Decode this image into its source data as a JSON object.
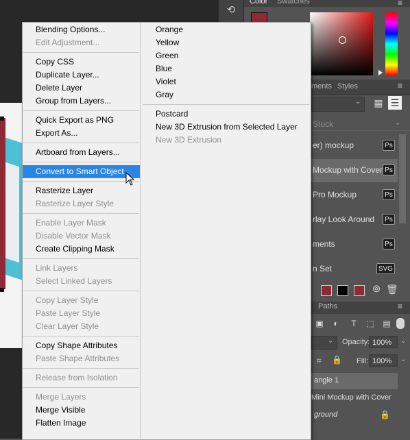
{
  "panels": {
    "color_tabs": [
      "Color",
      "Swatches"
    ],
    "library_tabs": [
      "ments",
      "Styles"
    ],
    "library_search": "Stock",
    "library_items": [
      {
        "label": "er) mockup",
        "badge": "Ps"
      },
      {
        "label": "Mockup with Cover",
        "badge": "Ps"
      },
      {
        "label": "Pro Mockup",
        "badge": "Ps"
      },
      {
        "label": "rlay Look Around",
        "badge": "Ps"
      },
      {
        "label": "ments",
        "badge": "Ps"
      },
      {
        "label": "n Set",
        "badge": "SVG"
      }
    ],
    "layers_tabs": [
      "Paths"
    ],
    "opacity_label": "Opacity:",
    "opacity_value": "100%",
    "fill_label": "Fill:",
    "fill_value": "100%",
    "layers": [
      "angle 1",
      "Mini Mockup with Cover",
      "ground"
    ]
  },
  "context_menu": {
    "main_groups": [
      [
        {
          "label": "Blending Options...",
          "enabled": true
        },
        {
          "label": "Edit Adjustment...",
          "enabled": false
        }
      ],
      [
        {
          "label": "Copy CSS",
          "enabled": true
        },
        {
          "label": "Duplicate Layer...",
          "enabled": true
        },
        {
          "label": "Delete Layer",
          "enabled": true
        },
        {
          "label": "Group from Layers...",
          "enabled": true
        }
      ],
      [
        {
          "label": "Quick Export as PNG",
          "enabled": true
        },
        {
          "label": "Export As...",
          "enabled": true
        }
      ],
      [
        {
          "label": "Artboard from Layers...",
          "enabled": true
        }
      ],
      [
        {
          "label": "Convert to Smart Object",
          "enabled": true,
          "highlighted": true
        }
      ],
      [
        {
          "label": "Rasterize Layer",
          "enabled": true
        },
        {
          "label": "Rasterize Layer Style",
          "enabled": false
        }
      ],
      [
        {
          "label": "Enable Layer Mask",
          "enabled": false
        },
        {
          "label": "Disable Vector Mask",
          "enabled": false
        },
        {
          "label": "Create Clipping Mask",
          "enabled": true
        }
      ],
      [
        {
          "label": "Link Layers",
          "enabled": false
        },
        {
          "label": "Select Linked Layers",
          "enabled": false
        }
      ],
      [
        {
          "label": "Copy Layer Style",
          "enabled": false
        },
        {
          "label": "Paste Layer Style",
          "enabled": false
        },
        {
          "label": "Clear Layer Style",
          "enabled": false
        }
      ],
      [
        {
          "label": "Copy Shape Attributes",
          "enabled": true
        },
        {
          "label": "Paste Shape Attributes",
          "enabled": false
        }
      ],
      [
        {
          "label": "Release from Isolation",
          "enabled": false
        }
      ],
      [
        {
          "label": "Merge Layers",
          "enabled": false
        },
        {
          "label": "Merge Visible",
          "enabled": true
        },
        {
          "label": "Flatten Image",
          "enabled": true
        }
      ]
    ],
    "color_labels": [
      "Orange",
      "Yellow",
      "Green",
      "Blue",
      "Violet",
      "Gray"
    ],
    "postcard_3d": [
      {
        "label": "Postcard",
        "enabled": true
      },
      {
        "label": "New 3D Extrusion from Selected Layer",
        "enabled": true
      },
      {
        "label": "New 3D Extrusion",
        "enabled": false
      }
    ]
  },
  "colors": {
    "menu_bg": "#f0f0f0",
    "highlight": "#2a86e6",
    "panel_bg": "#535353",
    "accent_red": "#8e2a35"
  }
}
